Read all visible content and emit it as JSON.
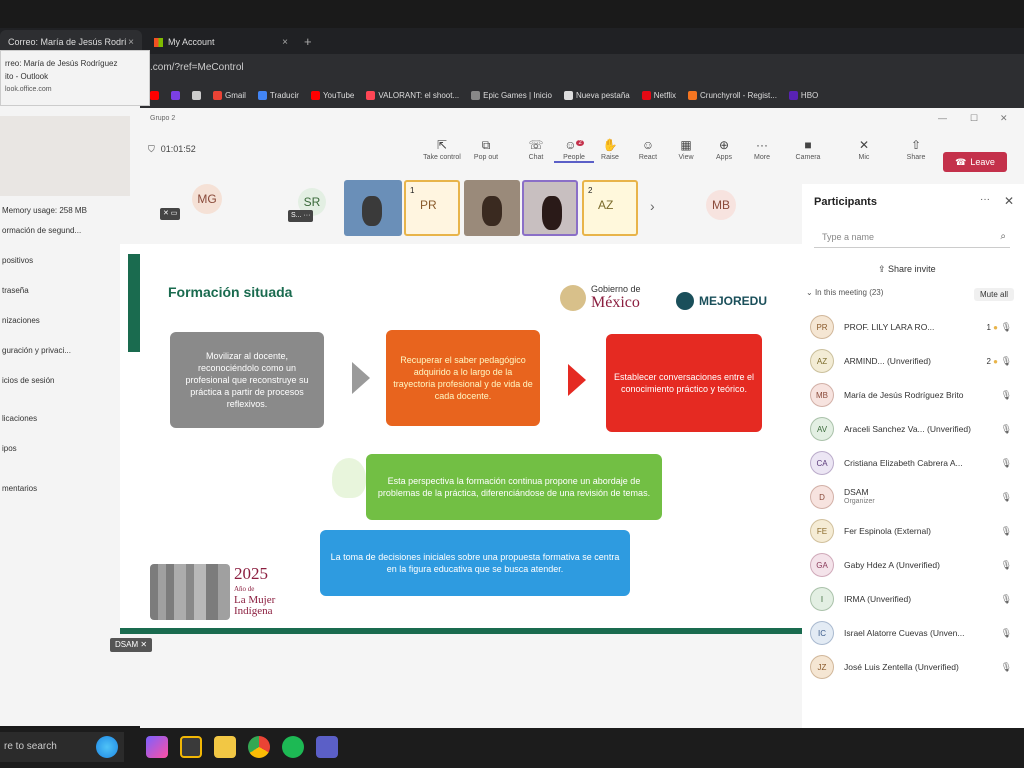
{
  "browser": {
    "tabs": [
      {
        "label": "Correo: María de Jesús Rodríguez",
        "close": "×"
      },
      {
        "label": "My Account",
        "close": "×"
      }
    ],
    "new_tab": "+",
    "url": ".com/?ref=MeControl",
    "bookmarks": [
      {
        "label": "Gmail",
        "color": "#ea4335"
      },
      {
        "label": "Traducir",
        "color": "#4285f4"
      },
      {
        "label": "YouTube",
        "color": "#ff0000"
      },
      {
        "label": "VALORANT: el shoot...",
        "color": "#ff4655"
      },
      {
        "label": "Epic Games | Inicio",
        "color": "#888888"
      },
      {
        "label": "Nueva pestaña",
        "color": "#dddddd"
      },
      {
        "label": "Netflix",
        "color": "#e50914"
      },
      {
        "label": "Crunchyroll - Regist...",
        "color": "#f47521"
      },
      {
        "label": "HBO",
        "color": "#5822b4"
      }
    ]
  },
  "tooltip": {
    "line1": "rreo: María de Jesús Rodríguez",
    "line2": "ito - Outlook",
    "line3": "look.office.com"
  },
  "left_window": {
    "items": [
      "Memory usage: 258 MB",
      "ormación de segund...",
      "positivos",
      "traseña",
      "nizaciones",
      "guración y privaci...",
      "icios de sesión",
      "licaciones",
      "ipos",
      "mentarios"
    ]
  },
  "teams": {
    "group_name": "Grupo 2",
    "timer": "01:01:52",
    "toolbar": [
      {
        "label": "Take control",
        "icon": "pointer-icon"
      },
      {
        "label": "Pop out",
        "icon": "popout-icon"
      },
      {
        "label": "Chat",
        "icon": "chat-icon"
      },
      {
        "label": "People",
        "icon": "people-icon",
        "badge": "2"
      },
      {
        "label": "Raise",
        "icon": "hand-icon"
      },
      {
        "label": "React",
        "icon": "smile-icon"
      },
      {
        "label": "View",
        "icon": "grid-icon"
      },
      {
        "label": "Apps",
        "icon": "plus-icon"
      },
      {
        "label": "More",
        "icon": "more-icon"
      },
      {
        "label": "Camera",
        "icon": "camera-icon"
      },
      {
        "label": "Mic",
        "icon": "mic-icon"
      },
      {
        "label": "Share",
        "icon": "share-icon"
      }
    ],
    "leave_label": "Leave",
    "strip": {
      "mg": "MG",
      "sr": "SR",
      "sr_label": "S... ···",
      "pr": "PR",
      "pr_num": "1",
      "az": "AZ",
      "az_num": "2",
      "mb": "MB",
      "next": "›"
    },
    "presenter_label": "DSAM"
  },
  "slide": {
    "title": "Formación situada",
    "logo_gov_top": "Gobierno de",
    "logo_gov_bottom": "México",
    "logo_mejoredu": "MEJOREDU",
    "box1": "Movilizar al docente, reconociéndolo como un profesional que reconstruye su práctica a partir de procesos reflexivos.",
    "box2": "Recuperar el saber pedagógico adquirido a lo largo de la trayectoria profesional y de vida de cada docente.",
    "box3": "Establecer conversaciones entre el conocimiento práctico y teórico.",
    "box4": "Esta perspectiva la formación continua propone un abordaje de problemas de la práctica, diferenciándose de una revisión de temas.",
    "box5": "La toma de decisiones iniciales sobre una propuesta formativa se centra en la figura educativa que se busca atender.",
    "brand_year": "2025",
    "brand_sub1": "Año de",
    "brand_sub2": "La Mujer",
    "brand_sub3": "Indígena"
  },
  "participants": {
    "title": "Participants",
    "search_placeholder": "Type a name",
    "share_invite": "Share invite",
    "in_meeting": "In this meeting (23)",
    "mute_all": "Mute all",
    "list": [
      {
        "initials": "PR",
        "name": "PROF. LILY LARA RO...",
        "hand": "1",
        "bg": "#f5e6d3",
        "fg": "#8a5a2b"
      },
      {
        "initials": "AZ",
        "name": "ARMIND... (Unverified)",
        "hand": "2",
        "bg": "#f3ecd5",
        "fg": "#7a6a2a"
      },
      {
        "initials": "MB",
        "name": "María de Jesús Rodríguez Brito",
        "bg": "#f7e3df",
        "fg": "#8a4a3a"
      },
      {
        "initials": "AV",
        "name": "Araceli Sanchez Va... (Unverified)",
        "bg": "#e3efe3",
        "fg": "#3a6a3a"
      },
      {
        "initials": "CA",
        "name": "Cristiana Elizabeth Cabrera A...",
        "bg": "#ece6f4",
        "fg": "#5a3a7a"
      },
      {
        "initials": "D",
        "name": "DSAM",
        "role": "Organizer",
        "bg": "#f7e3df",
        "fg": "#8a4a3a"
      },
      {
        "initials": "FE",
        "name": "Fer Espinola (External)",
        "bg": "#f5ecd5",
        "fg": "#8a6a2b"
      },
      {
        "initials": "GA",
        "name": "Gaby Hdez A (Unverified)",
        "bg": "#f4e3ea",
        "fg": "#8a3a5a"
      },
      {
        "initials": "I",
        "name": "IRMA (Unverified)",
        "bg": "#e3efe3",
        "fg": "#3a6a3a"
      },
      {
        "initials": "IC",
        "name": "Israel Alatorre Cuevas (Unven...",
        "bg": "#e3ebf4",
        "fg": "#3a5a8a"
      },
      {
        "initials": "JZ",
        "name": "José Luis Zentella (Unverified)",
        "bg": "#f5e6d3",
        "fg": "#8a5a2b"
      }
    ]
  },
  "taskbar": {
    "search": "re to search"
  }
}
